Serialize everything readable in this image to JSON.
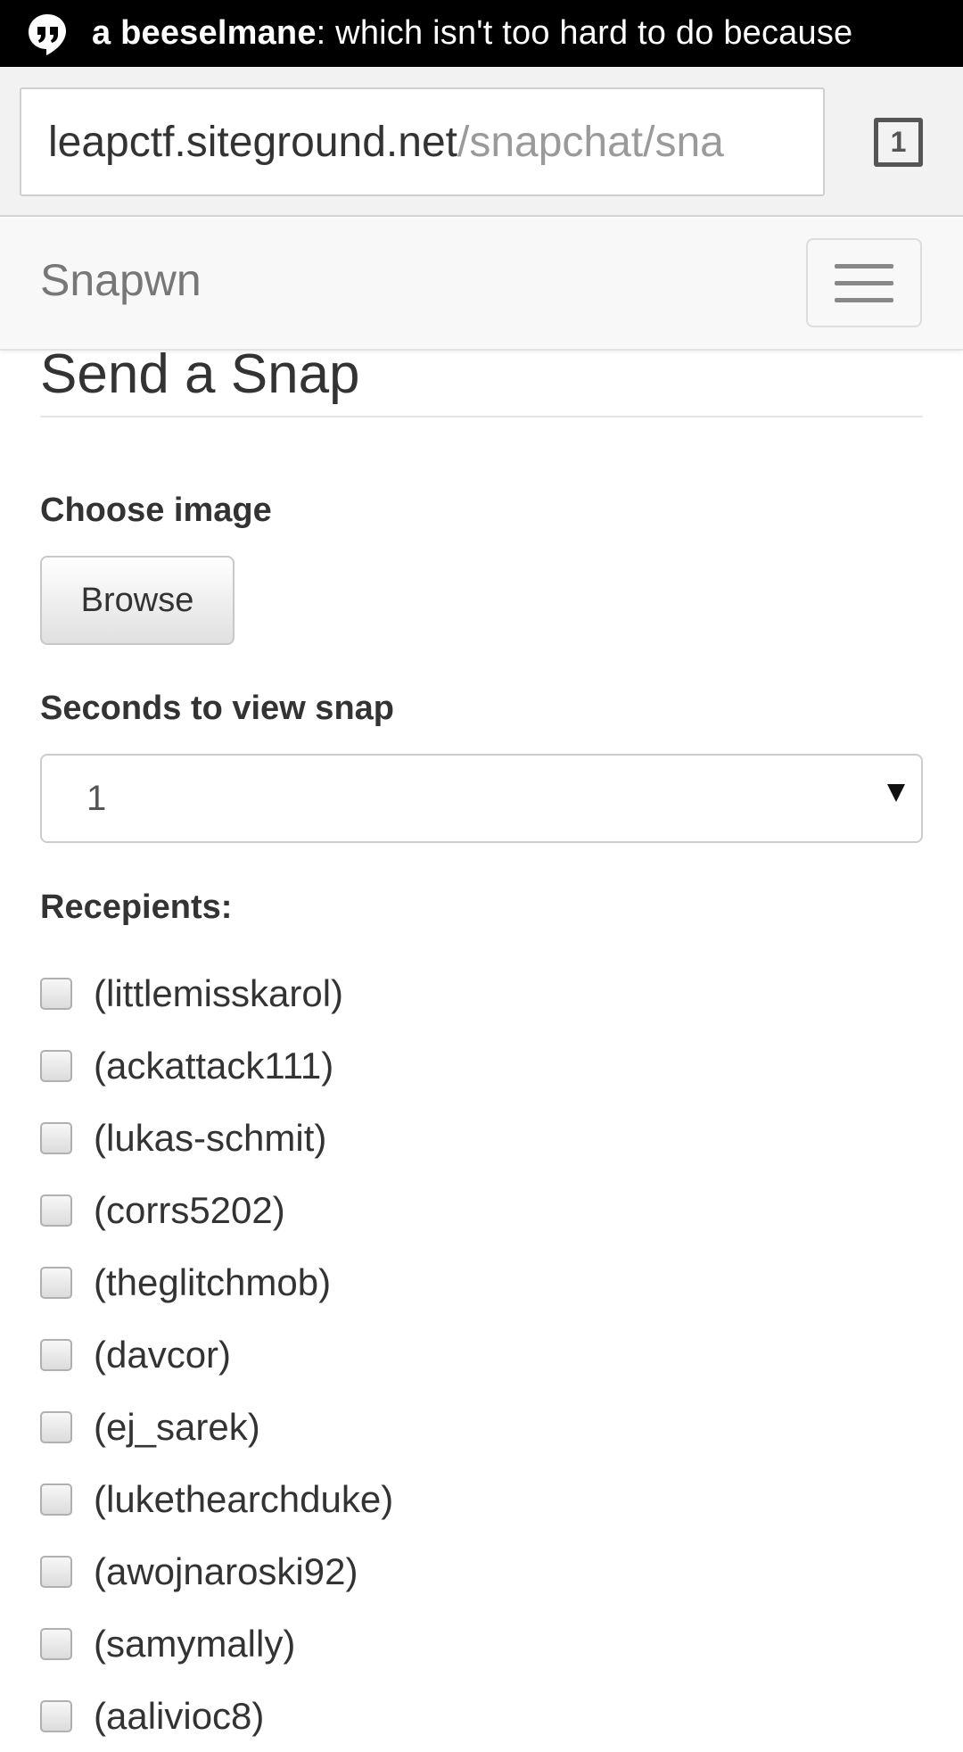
{
  "notification": {
    "sender": "a beeselmane",
    "message": ": which isn't too hard to do because"
  },
  "browser": {
    "url_host": "leapctf.siteground.net",
    "url_path": "/snapchat/sna",
    "tab_count": "1"
  },
  "navbar": {
    "brand": "Snapwn"
  },
  "form": {
    "title": "Send a Snap",
    "choose_image_label": "Choose image",
    "browse_label": "Browse",
    "seconds_label": "Seconds to view snap",
    "seconds_value": "1",
    "recipients_label": "Recepients:",
    "recipients": [
      "(littlemisskarol)",
      "(ackattack111)",
      "(lukas-schmit)",
      "(corrs5202)",
      "(theglitchmob)",
      "(davcor)",
      "(ej_sarek)",
      "(lukethearchduke)",
      "(awojnaroski92)",
      "(samymally)",
      "(aalivioc8)"
    ]
  }
}
